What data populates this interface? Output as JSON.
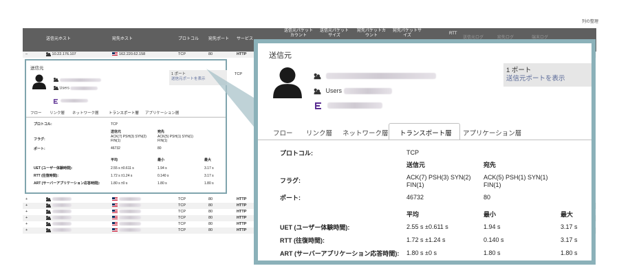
{
  "table": {
    "column_settings": "列の整理",
    "headers": {
      "src_host": "送信元ホスト",
      "dst_host": "宛先ホスト",
      "protocol": "プロトコル",
      "dst_port": "宛先ポート",
      "service": "サービス",
      "src_pkt_count": "送信元パケット カウント",
      "src_pkt_size": "送信元パケット サイズ",
      "dst_pkt_count": "宛先パケットカ ウント",
      "dst_pkt_size": "宛先パケットサ イズ",
      "rtt": "RTT",
      "uet_cut": "送信元ログ",
      "dst_log": "宛先ログ",
      "client_log": "端末ログ"
    },
    "expanded_row": {
      "toggle": "–",
      "src_ip": "10.22.176.107",
      "dst_ip": "162.220.62.158",
      "protocol": "TCP",
      "port": "80",
      "service": "HTTP"
    },
    "collapsed_rows": [
      {
        "toggle": "+",
        "protocol": "TCP",
        "port": "80",
        "service": "HTTP"
      },
      {
        "toggle": "+",
        "protocol": "TCP",
        "port": "80",
        "service": "HTTP"
      },
      {
        "toggle": "+",
        "protocol": "TCP",
        "port": "80",
        "service": "HTTP"
      },
      {
        "toggle": "+",
        "protocol": "TCP",
        "port": "80",
        "service": "HTTP"
      },
      {
        "toggle": "+",
        "protocol": "TCP",
        "port": "80",
        "service": "HTTP"
      },
      {
        "toggle": "+",
        "protocol": "TCP",
        "port": "80",
        "service": "HTTP"
      }
    ],
    "partial_row_protocol": "TCP"
  },
  "popup": {
    "title": "送信元",
    "users_label": "Users",
    "port_count": "1 ポート",
    "show_ports_link": "送信元ポートを表示",
    "tabs": [
      "フロー",
      "リンク層",
      "ネットワーク層",
      "トランスポート層",
      "アプリケーション層"
    ],
    "active_tab": "トランスポート層",
    "protocol_label": "プロトコル:",
    "protocol_value": "TCP",
    "src_header": "送信元",
    "dst_header": "宛先",
    "flags_label": "フラグ:",
    "flags_src": "ACK(7) PSH(3) SYN(2)",
    "flags_src_2": "FIN(1)",
    "flags_dst": "ACK(5) PSH(1) SYN(1)",
    "flags_dst_2": "FIN(1)",
    "port_label": "ポート:",
    "port_src": "46732",
    "port_dst": "80",
    "avg_header": "平均",
    "min_header": "最小",
    "max_header": "最大",
    "metrics": [
      {
        "label": "UET (ユーザー体験時間):",
        "avg": "2.55 s ±0.611 s",
        "min": "1.94 s",
        "max": "3.17 s"
      },
      {
        "label": "RTT (往復時間):",
        "avg": "1.72 s ±1.24 s",
        "min": "0.140 s",
        "max": "3.17 s"
      },
      {
        "label": "ART (サーバーアプリケーション応答時間):",
        "avg": "1.80 s ±0 s",
        "min": "1.80 s",
        "max": "1.80 s"
      }
    ]
  },
  "colors": {
    "header_bg": "#5f5f5f",
    "popup_border": "#8bb1b9",
    "link": "#5a6a98"
  }
}
